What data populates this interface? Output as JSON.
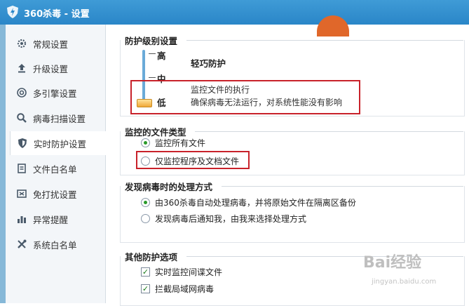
{
  "window": {
    "title": "360杀毒 - 设置"
  },
  "sidebar": {
    "items": [
      {
        "label": "常规设置",
        "icon": "gear-icon"
      },
      {
        "label": "升级设置",
        "icon": "upload-icon"
      },
      {
        "label": "多引擎设置",
        "icon": "engine-icon"
      },
      {
        "label": "病毒扫描设置",
        "icon": "search-icon"
      },
      {
        "label": "实时防护设置",
        "icon": "shield-icon"
      },
      {
        "label": "文件白名单",
        "icon": "file-icon"
      },
      {
        "label": "免打扰设置",
        "icon": "no-disturb-icon"
      },
      {
        "label": "异常提醒",
        "icon": "chart-icon"
      },
      {
        "label": "系统白名单",
        "icon": "tools-icon"
      }
    ],
    "active_index": 4
  },
  "protection_level": {
    "title": "防护级别设置",
    "levels": [
      "高",
      "中",
      "低"
    ],
    "selected": "低",
    "current_name": "轻巧防护",
    "desc_line1": "监控文件的执行",
    "desc_line2": "确保病毒无法运行，对系统性能没有影响"
  },
  "monitored_types": {
    "title": "监控的文件类型",
    "options": [
      {
        "label": "监控所有文件",
        "checked": true
      },
      {
        "label": "仅监控程序及文档文件",
        "checked": false
      }
    ]
  },
  "virus_action": {
    "title": "发现病毒时的处理方式",
    "options": [
      {
        "label": "由360杀毒自动处理病毒，并将原始文件在隔离区备份",
        "checked": true
      },
      {
        "label": "发现病毒后通知我，由我来选择处理方式",
        "checked": false
      }
    ]
  },
  "other_options": {
    "title": "其他防护选项",
    "options": [
      {
        "label": "实时监控间谍文件",
        "checked": true
      },
      {
        "label": "拦截局域网病毒",
        "checked": true
      }
    ]
  },
  "watermark": {
    "brand": "Bai经验",
    "url": "jingyan.baidu.com"
  },
  "colors": {
    "accent": "#2a86c8",
    "highlight": "#c8222a",
    "check": "#2a9a2a"
  }
}
